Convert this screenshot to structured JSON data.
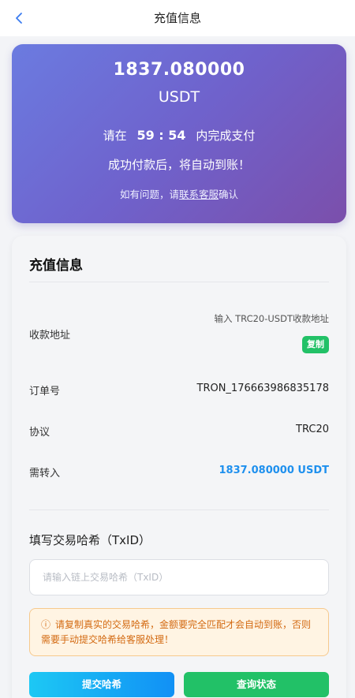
{
  "header": {
    "title": "充值信息",
    "back_icon": "chevron-left-icon"
  },
  "hero": {
    "amount": "1837.080000",
    "unit": "USDT",
    "countdown_prefix": "请在",
    "countdown_time": "59 : 54",
    "countdown_suffix": "内完成支付",
    "auto_note": "成功付款后，将自动到账！",
    "help_prefix": "如有问题，请",
    "help_link": "联系客服",
    "help_suffix": "确认"
  },
  "card": {
    "title": "充值信息",
    "rows": {
      "address_label": "收款地址",
      "address_hint": "输入 TRC20-USDT收款地址",
      "copy_label": "复制",
      "order_label": "订单号",
      "order_value": "TRON_176663986835178",
      "protocol_label": "协议",
      "protocol_value": "TRC20",
      "need_label": "需转入",
      "need_value": "1837.080000 USDT"
    },
    "txid_section": "填写交易哈希（TxID）",
    "txid_placeholder": "请输入链上交易哈希（TxID）",
    "txid_value": "",
    "warning_icon": "info-circle-icon",
    "warning": "请复制真实的交易哈希，金额要完全匹配才会自动到账，否则需要手动提交哈希给客服处理！",
    "submit_label": "提交哈希",
    "query_label": "查询状态"
  },
  "colors": {
    "hero_gradient_start": "#6b7be0",
    "hero_gradient_end": "#7b4fab",
    "accent_blue": "#1e90ee",
    "accent_green": "#22c167",
    "warning_text": "#d36a12"
  }
}
